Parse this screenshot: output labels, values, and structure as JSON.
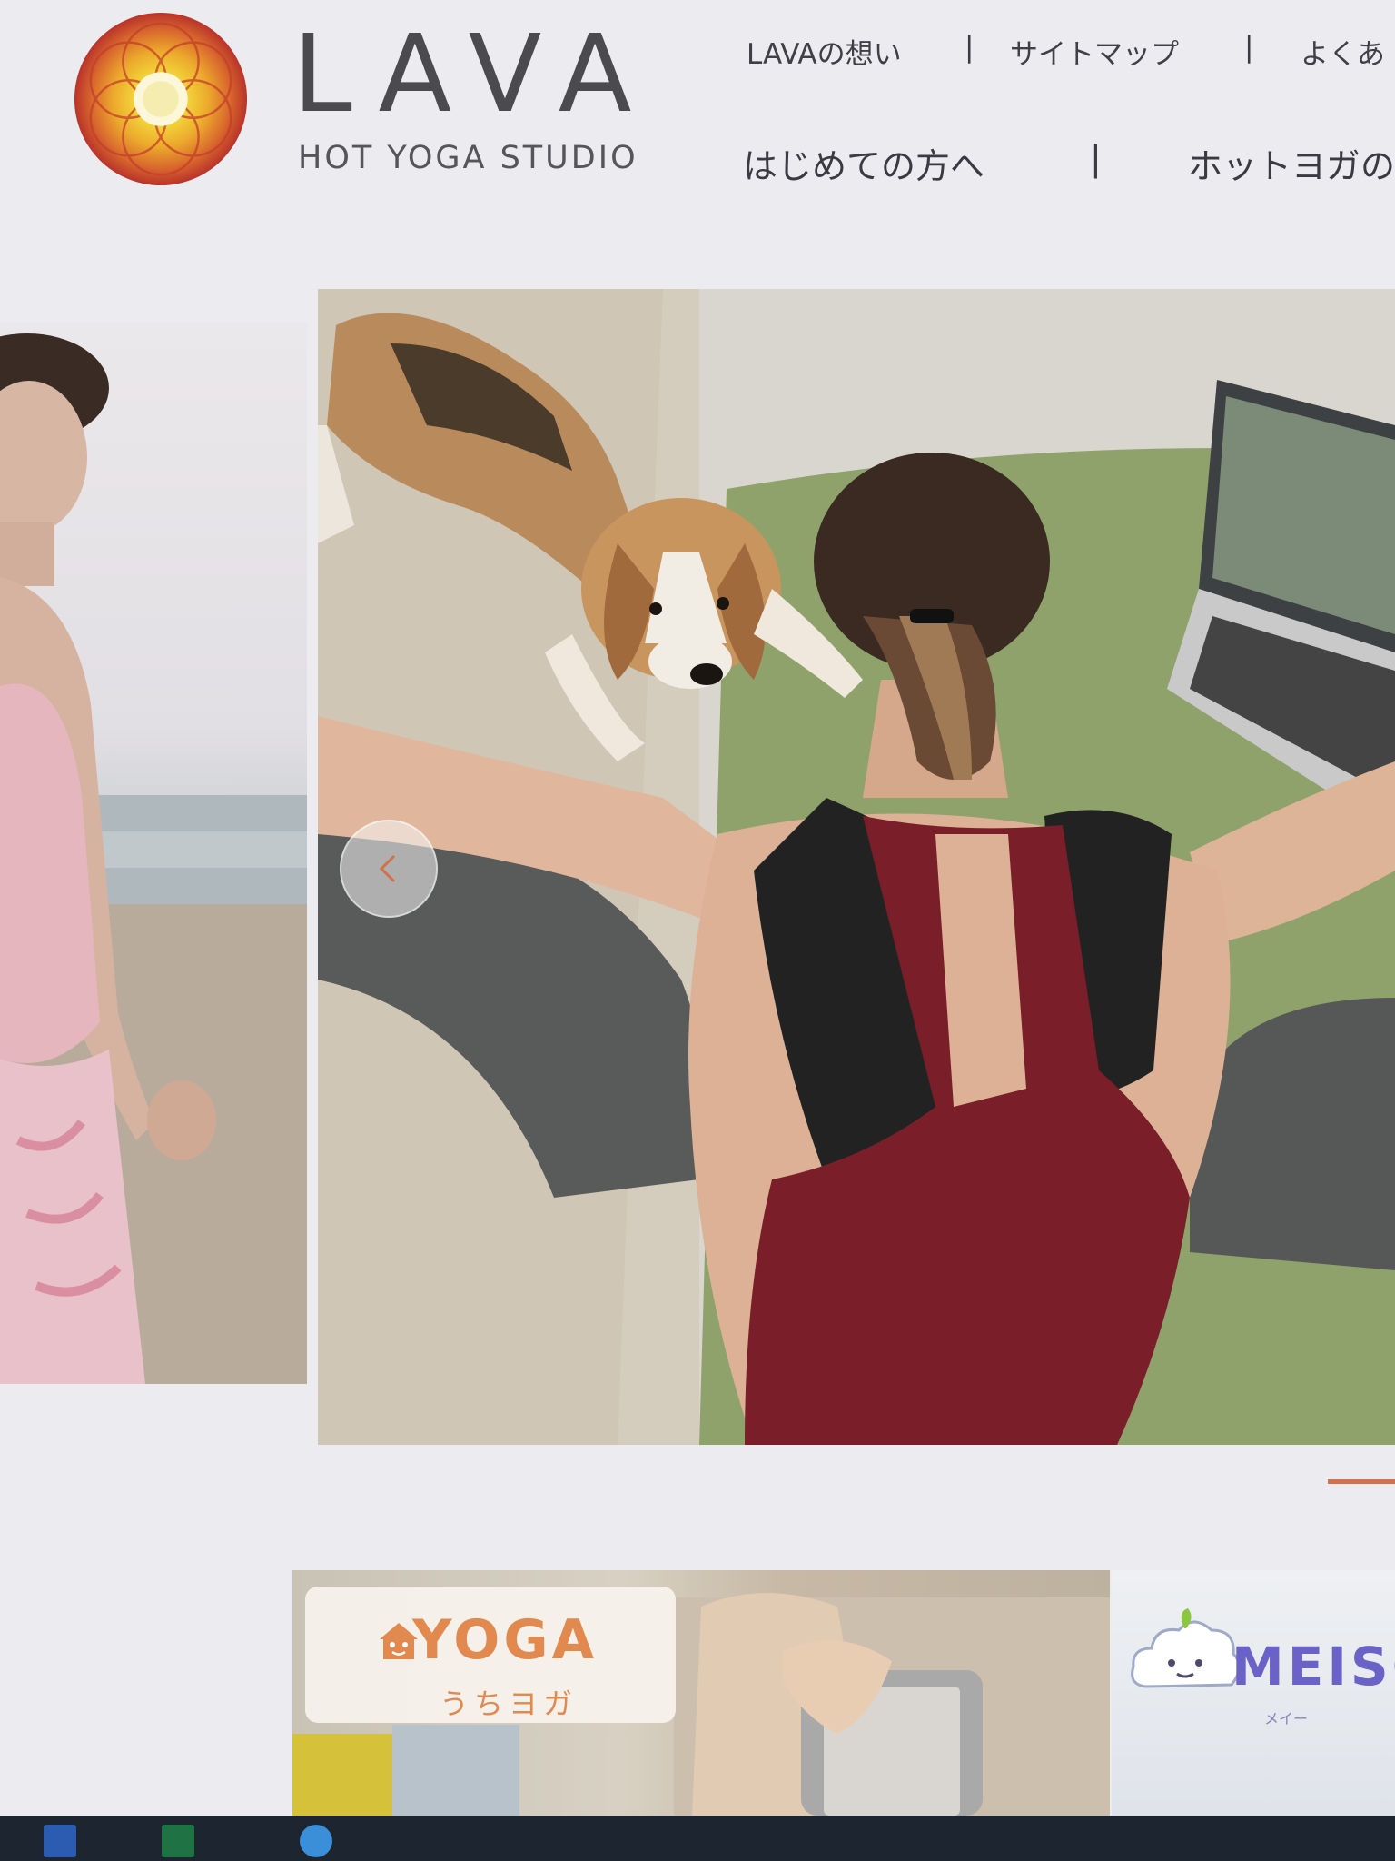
{
  "brand": {
    "wordmark": "LAVA",
    "tagline": "HOT YOGA STUDIO",
    "logo_colors": [
      "#c8442a",
      "#e0862f",
      "#f1b52e",
      "#f6d84a"
    ]
  },
  "util_nav": [
    {
      "label": "LAVAの想い"
    },
    {
      "label": "サイトマップ"
    },
    {
      "label": "よくあ"
    }
  ],
  "main_nav": [
    {
      "label": "はじめての方へ"
    },
    {
      "label": "ホットヨガの"
    }
  ],
  "separator": "|",
  "slider": {
    "prev_icon": "chevron-left-icon",
    "prev_glyph": "<",
    "accent": "#d2714b"
  },
  "cards": {
    "yoga": {
      "title": "YOGA",
      "subtitle": "うちヨガ",
      "icon": "house-icon",
      "color": "#e2894f"
    },
    "meiso": {
      "title": "MEISO",
      "subtitle": "メイー",
      "icon": "cloud-icon",
      "color": "#6a62c7"
    }
  },
  "taskbar": {
    "icons": [
      "word-icon",
      "excel-icon",
      "edge-icon"
    ]
  }
}
